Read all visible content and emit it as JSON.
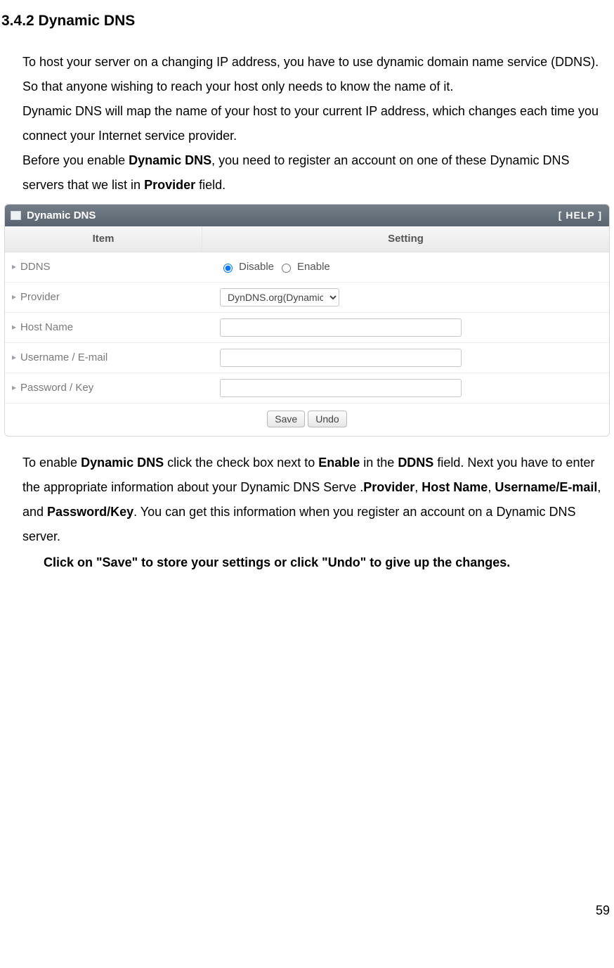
{
  "heading": "3.4.2 Dynamic DNS",
  "intro": {
    "p1a": "To host your server on a changing IP address, you have to use dynamic domain name service (DDNS). So that anyone wishing to reach your host only needs to know the name of it.",
    "p1b": "Dynamic DNS will map the name of your host to your current IP address, which changes each time you connect your Internet service provider.",
    "p2_before": "Before you enable ",
    "p2_bold1": "Dynamic DNS",
    "p2_mid": ", you need to register an account on one of these Dynamic DNS servers that we list in ",
    "p2_bold2": "Provider",
    "p2_after": " field."
  },
  "panel": {
    "title": "Dynamic DNS",
    "help": "[ HELP ]",
    "col_item": "Item",
    "col_setting": "Setting",
    "rows": {
      "ddns_label": "DDNS",
      "ddns_disable": "Disable",
      "ddns_enable": "Enable",
      "provider_label": "Provider",
      "provider_value": "DynDNS.org(Dynamic)",
      "hostname_label": "Host Name",
      "username_label": "Username / E-mail",
      "password_label": "Password / Key"
    },
    "buttons": {
      "save": "Save",
      "undo": "Undo"
    }
  },
  "outro": {
    "a": "To enable ",
    "b1": "Dynamic DNS",
    "c": " click the check box next to ",
    "b2": "Enable",
    "d": " in the ",
    "b3": "DDNS",
    "e": " field. Next you have to enter the appropriate information about your Dynamic DNS Serve .",
    "b4": "Provider",
    "f": ", ",
    "b5": "Host Name",
    "g": ", ",
    "b6": "Username/E-mail",
    "h": ", and ",
    "b7": "Password/Key",
    "i": ". You can get this information when you register an account on a Dynamic DNS server.",
    "save_note": "Click on \"Save\" to store your settings or click \"Undo\" to give up the changes."
  },
  "page_number": "59"
}
